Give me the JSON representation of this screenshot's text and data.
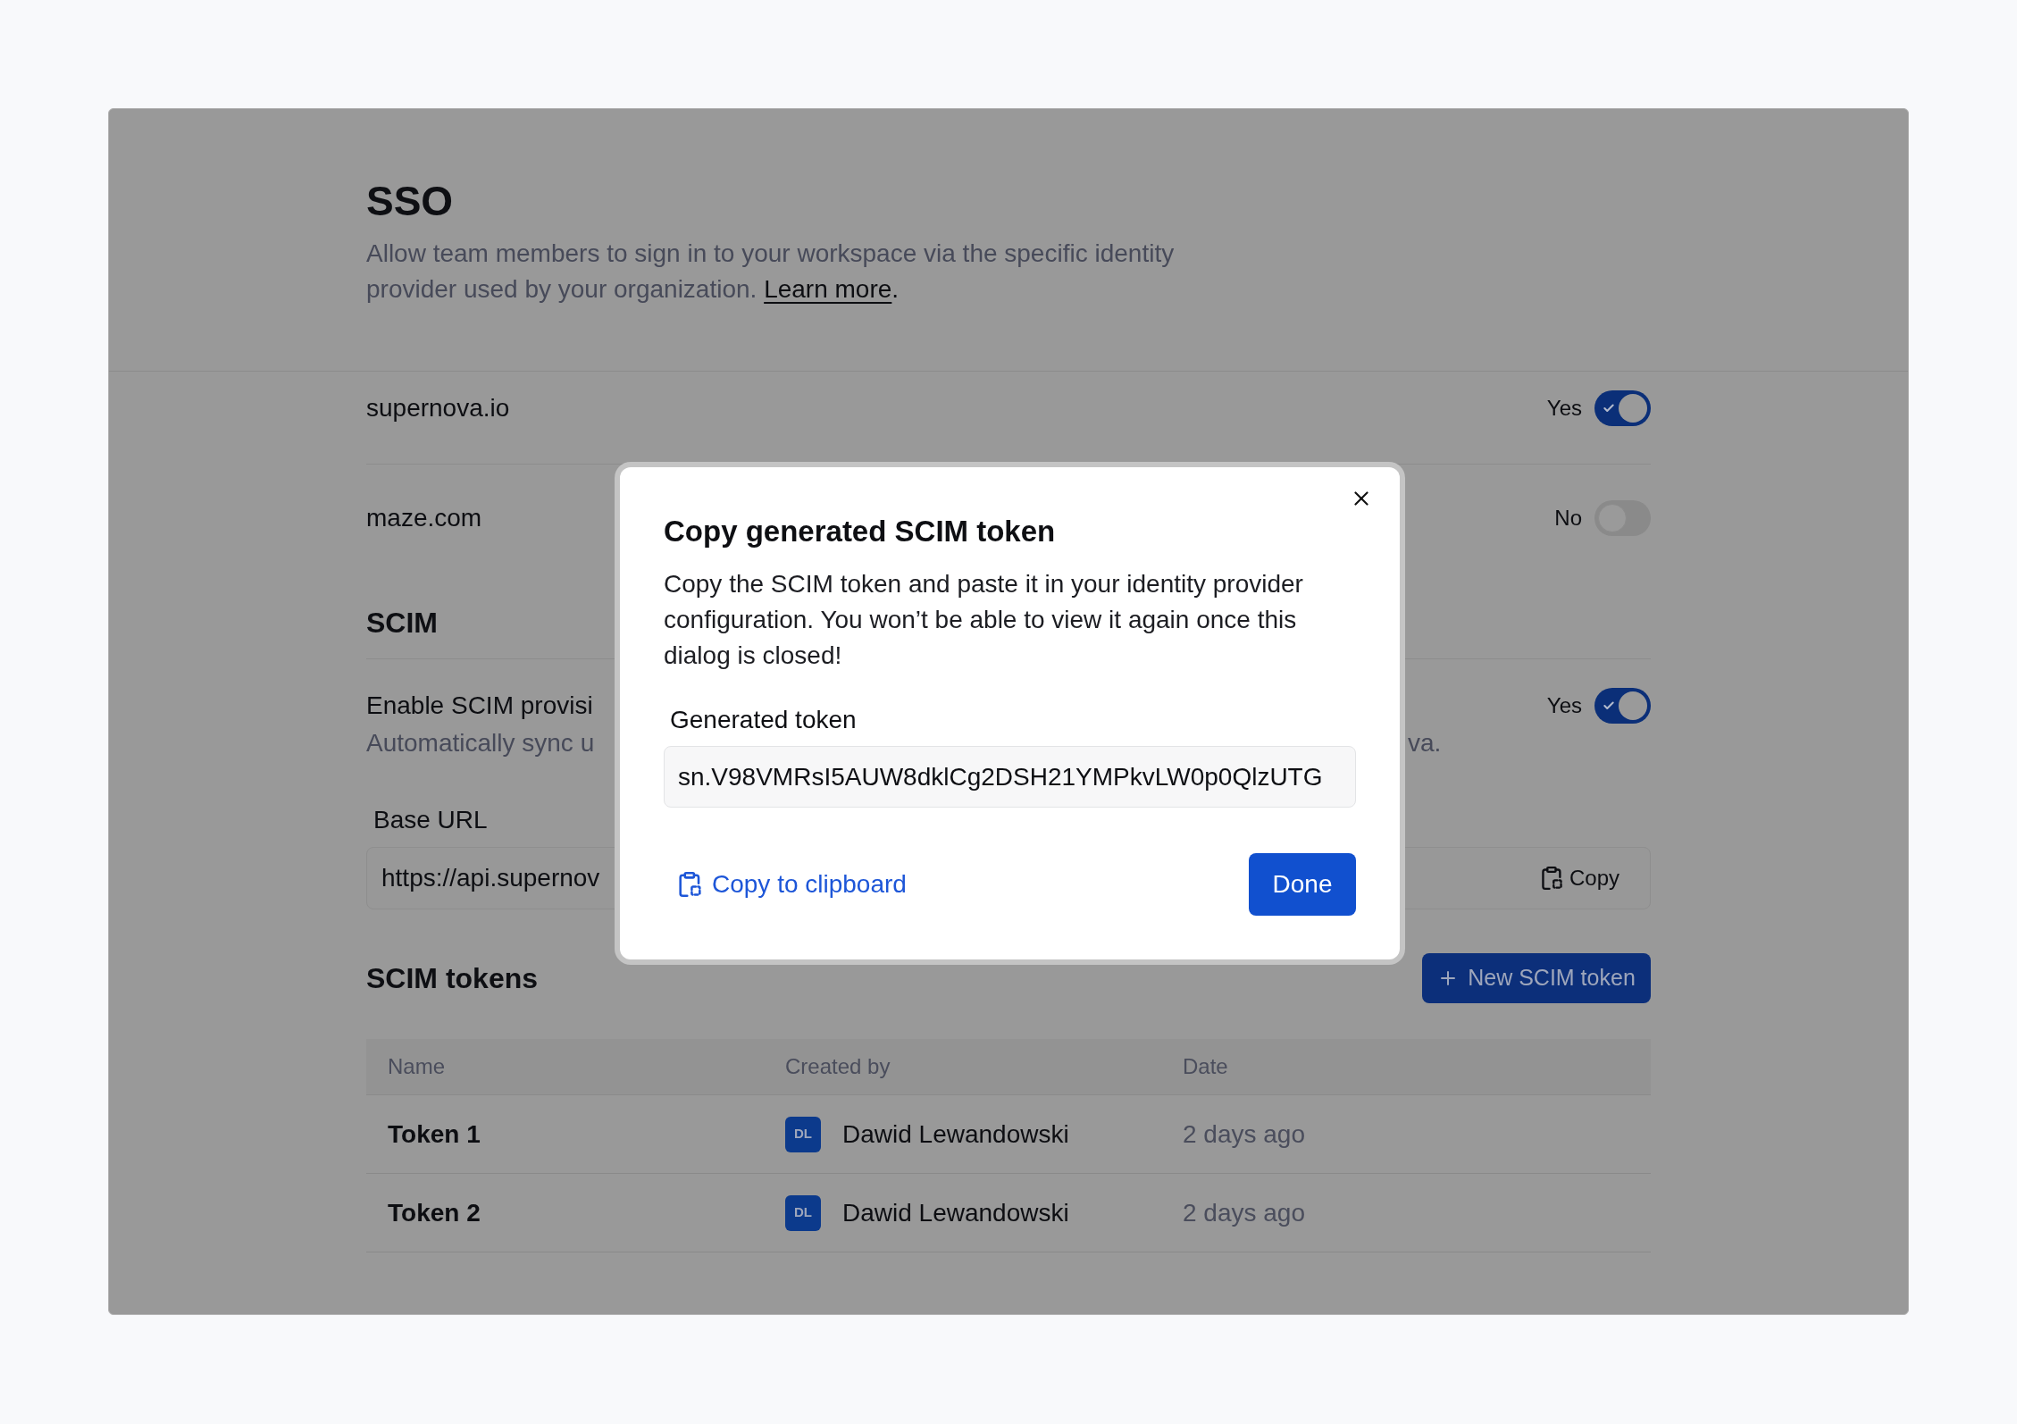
{
  "sso": {
    "title": "SSO",
    "description": "Allow team members to sign in to your workspace via the specific identity provider used by your organization.",
    "link": "Learn more",
    "link_suffix": "."
  },
  "domains": [
    {
      "name": "supernova.io",
      "toggle_label": "Yes",
      "on": true
    },
    {
      "name": "maze.com",
      "toggle_label": "No",
      "on": false
    }
  ],
  "scim": {
    "title": "SCIM",
    "provisioning": {
      "label": "Enable SCIM provisi",
      "description": "Automatically sync u",
      "description_tail": "va.",
      "toggle_label": "Yes",
      "on": true
    },
    "base_url": {
      "label": "Base URL",
      "value": "https://api.supernov",
      "copy_button": "Copy"
    }
  },
  "tokens": {
    "title": "SCIM tokens",
    "new_button": "New SCIM token",
    "columns": [
      "Name",
      "Created by",
      "Date"
    ],
    "rows": [
      {
        "name": "Token 1",
        "avatar": "DL",
        "created_by": "Dawid Lewandowski",
        "date": "2 days ago"
      },
      {
        "name": "Token 2",
        "avatar": "DL",
        "created_by": "Dawid Lewandowski",
        "date": "2 days ago"
      }
    ]
  },
  "dialog": {
    "title": "Copy generated SCIM token",
    "description": "Copy the SCIM token and paste it in your identity provider configuration. You won’t be able to view it again once this dialog is closed!",
    "field_label": "Generated token",
    "token": "sn.V98VMRsI5AUW8dklCg2DSH21YMPkvLW0p0QlzUTG",
    "copy_button": "Copy to clipboard",
    "done_button": "Done"
  }
}
